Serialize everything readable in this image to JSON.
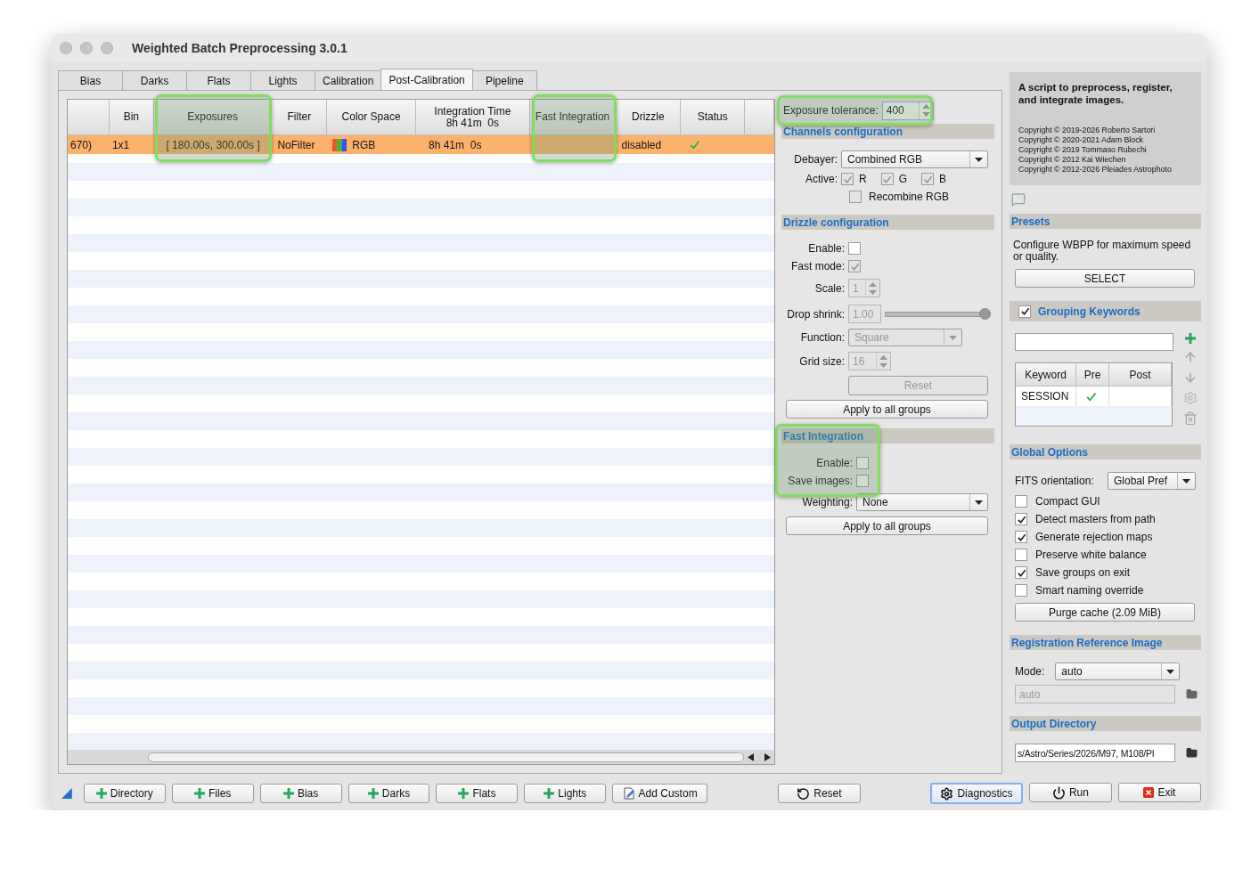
{
  "window": {
    "title": "Weighted Batch Preprocessing 3.0.1"
  },
  "tabs": [
    {
      "label": "Bias",
      "selected": false
    },
    {
      "label": "Darks",
      "selected": false
    },
    {
      "label": "Flats",
      "selected": false
    },
    {
      "label": "Lights",
      "selected": false
    },
    {
      "label": "Calibration",
      "selected": false
    },
    {
      "label": "Post-Calibration",
      "selected": true
    },
    {
      "label": "Pipeline",
      "selected": false
    }
  ],
  "table": {
    "columns": [
      {
        "highlighted": false
      },
      {
        "label": "Bin",
        "highlighted": false
      },
      {
        "label": "Exposures",
        "highlighted": true
      },
      {
        "label": "Filter",
        "highlighted": false
      },
      {
        "label": "Color Space",
        "highlighted": false
      },
      {
        "label": "Integration Time",
        "sublabel": "8h 41m  0s",
        "highlighted": false
      },
      {
        "label": "Fast Integration",
        "highlighted": true
      },
      {
        "label": "Drizzle",
        "highlighted": false
      },
      {
        "label": "Status",
        "highlighted": false
      },
      {
        "highlighted": false
      }
    ],
    "rows": [
      {
        "selected": true,
        "cells": [
          {
            "kind": "text",
            "text": "670)"
          },
          {
            "kind": "text",
            "text": "1x1"
          },
          {
            "kind": "text",
            "text": "[ 180.00s, 300.00s ]"
          },
          {
            "kind": "text",
            "text": "NoFilter"
          },
          {
            "kind": "color",
            "text": "RGB"
          },
          {
            "kind": "text",
            "text": "8h 41m  0s"
          },
          {
            "kind": "empty"
          },
          {
            "kind": "text",
            "text": "disabled"
          },
          {
            "kind": "check",
            "checked": true
          },
          {
            "kind": "empty"
          }
        ]
      }
    ]
  },
  "exposure_tolerance": {
    "label": "Exposure tolerance:",
    "value": "400",
    "highlighted": true
  },
  "channels": {
    "title": "Channels configuration",
    "debayer": {
      "label": "Debayer:",
      "value": "Combined RGB"
    },
    "active": {
      "label": "Active:",
      "channels": [
        {
          "label": "R",
          "checked": true,
          "disabled": true
        },
        {
          "label": "G",
          "checked": true,
          "disabled": true
        },
        {
          "label": "B",
          "checked": true,
          "disabled": true
        }
      ]
    },
    "recombine": {
      "label": "Recombine RGB",
      "checked": false,
      "disabled": true
    }
  },
  "drizzle": {
    "title": "Drizzle configuration",
    "enable": {
      "label": "Enable:",
      "checked": false
    },
    "fast_mode": {
      "label": "Fast mode:",
      "checked": true,
      "disabled": true
    },
    "scale": {
      "label": "Scale:",
      "value": "1",
      "disabled": true
    },
    "drop_shrink": {
      "label": "Drop shrink:",
      "value": "1.00",
      "level": 0.96,
      "disabled": true
    },
    "function": {
      "label": "Function:",
      "value": "Square",
      "disabled": true
    },
    "grid_size": {
      "label": "Grid size:",
      "value": "16",
      "disabled": true
    },
    "reset_button": {
      "label": "Reset",
      "disabled": true
    },
    "apply_button": "Apply to all groups"
  },
  "fast_integration": {
    "title": "Fast Integration",
    "highlighted": true,
    "enable": {
      "label": "Enable:",
      "checked": false
    },
    "save_images": {
      "label": "Save images:",
      "checked": false
    },
    "weighting": {
      "label": "Weighting:",
      "value": "None"
    },
    "apply_button": "Apply to all groups"
  },
  "about": {
    "headline": "A script to preprocess, register, and integrate images.",
    "copyrights": [
      "Copyright © 2019-2026 Roberto Sartori",
      "Copyright © 2020-2021 Adam Block",
      "Copyright © 2019 Tommaso Rubechi",
      "Copyright © 2012 Kai Wiechen",
      "Copyright © 2012-2026 Pleiades Astrophoto"
    ]
  },
  "presets": {
    "title": "Presets",
    "description": "Configure WBPP for maximum speed or quality.",
    "button": "SELECT"
  },
  "grouping_keywords": {
    "title": "Grouping Keywords",
    "checked": true,
    "columns": [
      "Keyword",
      "Pre",
      "Post"
    ],
    "rows": [
      {
        "keyword": "SESSION",
        "pre": true,
        "post": false
      }
    ]
  },
  "global_options": {
    "title": "Global Options",
    "fits_orientation": {
      "label": "FITS orientation:",
      "value": "Global Pref"
    },
    "options": [
      {
        "label": "Compact GUI",
        "checked": false
      },
      {
        "label": "Detect masters from path",
        "checked": true
      },
      {
        "label": "Generate rejection maps",
        "checked": true
      },
      {
        "label": "Preserve white balance",
        "checked": false
      },
      {
        "label": "Save groups on exit",
        "checked": true
      },
      {
        "label": "Smart naming override",
        "checked": false
      }
    ],
    "purge_button": "Purge cache (2.09 MiB)"
  },
  "registration": {
    "title": "Registration Reference Image",
    "mode": {
      "label": "Mode:",
      "value": "auto"
    },
    "path": {
      "value": "auto",
      "disabled": true
    }
  },
  "output_directory": {
    "title": "Output Directory",
    "value": "s/Astro/Series/2026/M97, M108/PI"
  },
  "bottom_bar": {
    "left": [
      {
        "label": "Directory",
        "kind": "add",
        "focused": false
      },
      {
        "label": "Files",
        "kind": "add",
        "focused": false
      },
      {
        "label": "Bias",
        "kind": "add",
        "focused": false
      },
      {
        "label": "Darks",
        "kind": "add",
        "focused": false
      },
      {
        "label": "Flats",
        "kind": "add",
        "focused": false
      },
      {
        "label": "Lights",
        "kind": "add",
        "focused": false
      },
      {
        "label": "Add Custom",
        "kind": "custom",
        "focused": false
      }
    ],
    "middle": [
      {
        "label": "Reset",
        "kind": "reset",
        "focused": false
      }
    ],
    "right": [
      {
        "label": "Diagnostics",
        "kind": "gear",
        "focused": true
      },
      {
        "label": "Run",
        "kind": "power",
        "focused": false
      },
      {
        "label": "Exit",
        "kind": "exit",
        "focused": false
      }
    ]
  }
}
